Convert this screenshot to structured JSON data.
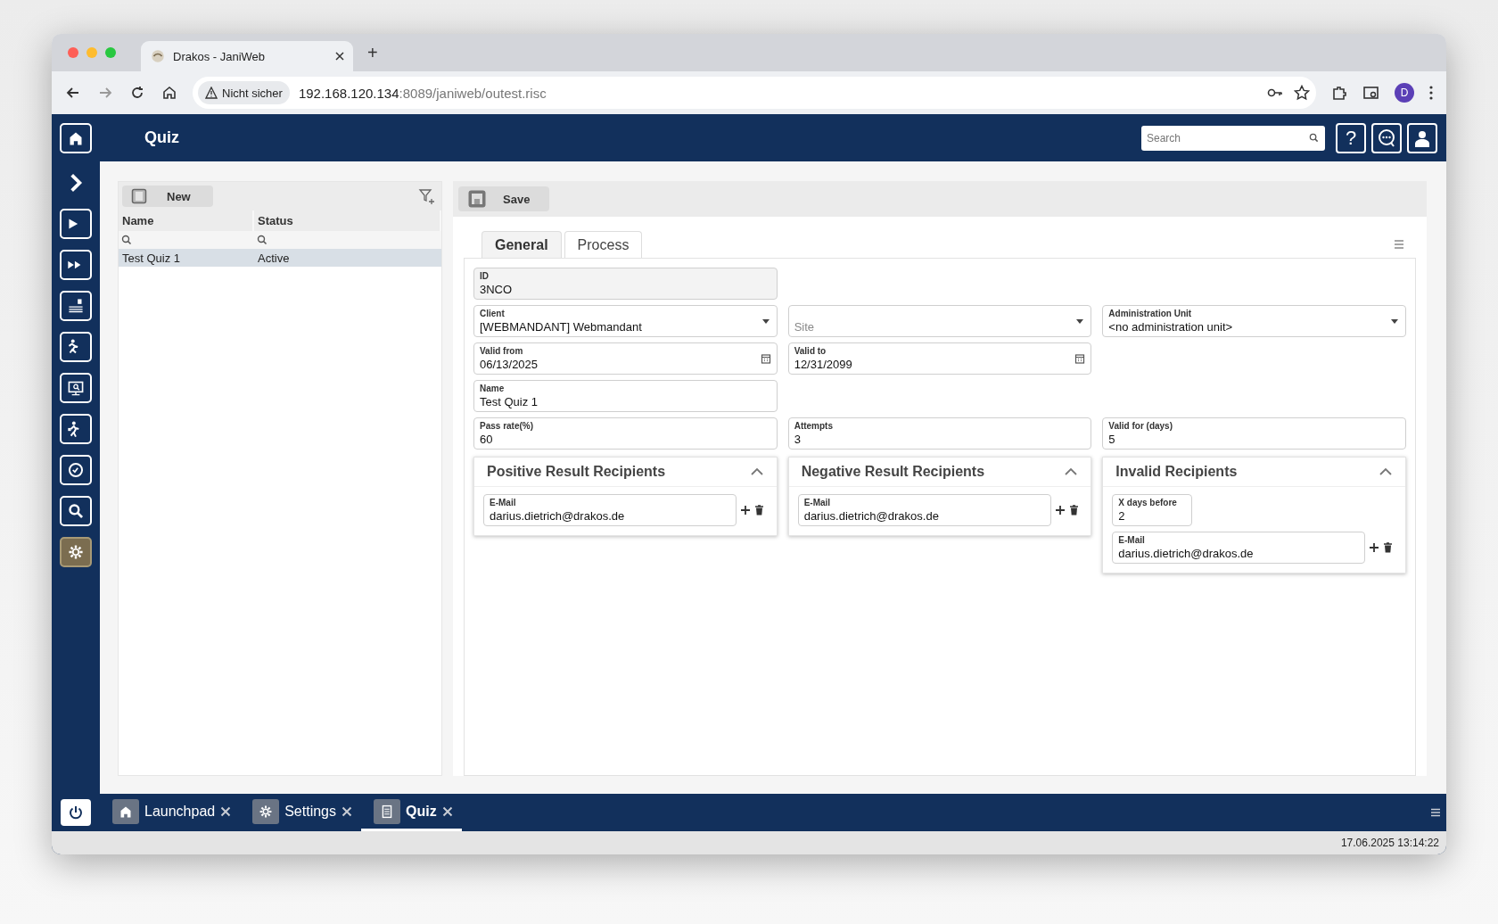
{
  "browser": {
    "tab_title": "Drakos - JaniWeb",
    "new_tab": "+",
    "security": "Nicht sicher",
    "url_host": "192.168.120.134",
    "url_rest": ":8089/janiweb/outest.risc",
    "profile": "D"
  },
  "header": {
    "title": "Quiz",
    "search": {
      "placeholder": "Search"
    },
    "help": "?"
  },
  "sidebar": [
    {
      "kind": "chevron",
      "selected": false
    },
    {
      "kind": "play",
      "selected": false
    },
    {
      "kind": "forward",
      "selected": false
    },
    {
      "kind": "card",
      "selected": false
    },
    {
      "kind": "runner",
      "selected": false
    },
    {
      "kind": "monitor",
      "selected": false
    },
    {
      "kind": "walker",
      "selected": false
    },
    {
      "kind": "clock",
      "selected": false
    },
    {
      "kind": "search",
      "selected": false
    },
    {
      "kind": "gear",
      "selected": true
    }
  ],
  "list": {
    "new_button": "New",
    "columns": [
      "Name",
      "Status"
    ],
    "rows": [
      {
        "cells": [
          "Test Quiz 1",
          "Active"
        ],
        "selected": true
      }
    ]
  },
  "detail": {
    "save_button": "Save",
    "tabs": [
      {
        "label": "General",
        "selected": true
      },
      {
        "label": "Process",
        "selected": false
      }
    ],
    "rows": [
      [
        {
          "kind": "readonly",
          "label": "ID",
          "value": "3NCO"
        }
      ],
      [
        {
          "kind": "select",
          "label": "Client",
          "value": "[WEBMANDANT] Webmandant"
        },
        {
          "kind": "select",
          "placeholder": "Site"
        },
        {
          "kind": "select",
          "label": "Administration Unit",
          "value": "<no administration unit>"
        }
      ],
      [
        {
          "kind": "date",
          "label": "Valid from",
          "value": "06/13/2025"
        },
        {
          "kind": "date",
          "label": "Valid to",
          "value": "12/31/2099"
        }
      ],
      [
        {
          "kind": "text",
          "label": "Name",
          "value": "Test Quiz 1"
        }
      ],
      [
        {
          "kind": "text",
          "label": "Pass rate(%)",
          "value": "60"
        },
        {
          "kind": "text",
          "label": "Attempts",
          "value": "3"
        },
        {
          "kind": "text",
          "label": "Valid for (days)",
          "value": "5"
        }
      ]
    ],
    "panels": [
      {
        "title": "Positive Result Recipients",
        "expanded": true,
        "fields": [
          {
            "kind": "email",
            "label": "E-Mail",
            "value": "darius.dietrich@drakos.de"
          }
        ]
      },
      {
        "title": "Negative Result Recipients",
        "expanded": true,
        "fields": [
          {
            "kind": "email",
            "label": "E-Mail",
            "value": "darius.dietrich@drakos.de"
          }
        ]
      },
      {
        "title": "Invalid Recipients",
        "expanded": true,
        "fields": [
          {
            "kind": "number",
            "label": "X days before",
            "value": "2"
          },
          {
            "kind": "email",
            "label": "E-Mail",
            "value": "darius.dietrich@drakos.de"
          }
        ]
      }
    ]
  },
  "taskbar": [
    {
      "kind": "home",
      "label": "Launchpad",
      "selected": false
    },
    {
      "kind": "gear",
      "label": "Settings",
      "selected": false
    },
    {
      "kind": "document",
      "label": "Quiz",
      "selected": true
    }
  ],
  "status_bar": {
    "datetime": "17.06.2025 13:14:22"
  }
}
